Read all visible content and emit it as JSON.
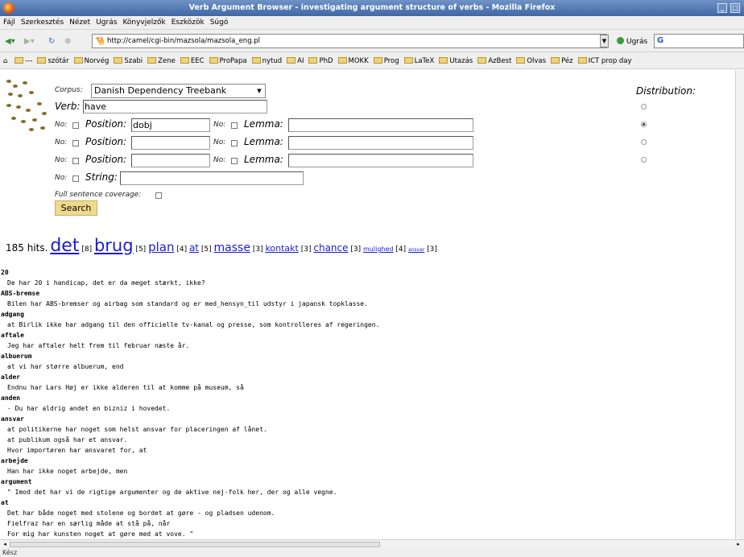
{
  "window": {
    "title": "Verb Argument Browser - investigating argument structure of verbs - Mozilla Firefox"
  },
  "menu": [
    "Fájl",
    "Szerkesztés",
    "Nézet",
    "Ugrás",
    "Könyvjelzők",
    "Eszközök",
    "Súgó"
  ],
  "nav": {
    "url": "http://camel/cgi-bin/mazsola/mazsola_eng.pl",
    "go_label": "Ugrás",
    "search_value": "G"
  },
  "bookmarks": [
    "---",
    "szótár",
    "Norvég",
    "Szabi",
    "Zene",
    "EEC",
    "ProPapa",
    "nytud",
    "AI",
    "PhD",
    "MOKK",
    "Prog",
    "LaTeX",
    "Utazás",
    "AzBest",
    "Olvas",
    "Péz",
    "ICT prop day"
  ],
  "form": {
    "corpus_label": "Corpus:",
    "corpus_value": "Danish Dependency Treebank",
    "verb_label": "Verb:",
    "verb_value": "have",
    "no_label": "No:",
    "position_label": "Position:",
    "lemma_label": "Lemma:",
    "string_label": "String:",
    "rows": [
      {
        "position": "dobj",
        "lemma": ""
      },
      {
        "position": "",
        "lemma": ""
      },
      {
        "position": "",
        "lemma": ""
      }
    ],
    "string_value": "",
    "coverage_label": "Full sentence coverage:",
    "search_label": "Search",
    "distribution_label": "Distribution:"
  },
  "hits": {
    "count_text": "185 hits.",
    "items": [
      {
        "word": "det",
        "count": "[8]"
      },
      {
        "word": "brug",
        "count": "[5]"
      },
      {
        "word": "plan",
        "count": "[4]"
      },
      {
        "word": "at",
        "count": "[5]"
      },
      {
        "word": "masse",
        "count": "[3]"
      },
      {
        "word": "kontakt",
        "count": "[3]"
      },
      {
        "word": "chance",
        "count": "[3]"
      },
      {
        "word": "mulighed",
        "count": "[4]"
      },
      {
        "word": "ansvar",
        "count": "[3]"
      }
    ]
  },
  "results": [
    {
      "word": "20",
      "sentences": [
        "De har 20 i handicap, det er da meget stærkt, ikke?"
      ]
    },
    {
      "word": "ABS-bremse",
      "sentences": [
        "Bilen har ABS-bremser og airbag som standard og er med_hensyn_til udstyr i japansk topklasse."
      ]
    },
    {
      "word": "adgang",
      "sentences": [
        "at Birlik ikke har adgang til den officielle tv-kanal og presse, som kontrolleres af regeringen."
      ]
    },
    {
      "word": "aftale",
      "sentences": [
        "Jeg har aftaler helt frem til februar næste år."
      ]
    },
    {
      "word": "albuerum",
      "sentences": [
        "at vi har større albuerum, end"
      ]
    },
    {
      "word": "alder",
      "sentences": [
        "Endnu har Lars Høj er ikke alderen til at komme på museum, så"
      ]
    },
    {
      "word": "anden",
      "sentences": [
        "- Du har aldrig andet en bizniz i hovedet."
      ]
    },
    {
      "word": "ansvar",
      "sentences": [
        "at politikerne har noget som helst ansvar for placeringen af lånet.",
        "at publikum også har et ansvar.",
        "Hvor importøren har ansvaret for, at"
      ]
    },
    {
      "word": "arbejde",
      "sentences": [
        "Han har ikke noget arbejde, men"
      ]
    },
    {
      "word": "argument",
      "sentences": [
        "\" Imod det har vi de rigtige argumenter og de aktive nej-folk her, der og alle vegne."
      ]
    },
    {
      "word": "at",
      "sentences": [
        "Det har både noget med stolene og bordet at gøre - og pladsen udenom.",
        "Fielfraz har en særlig måde at stå på, når",
        "For mig har kunsten noget at gøre med at vove. \""
      ]
    }
  ],
  "status": {
    "text": "Kész"
  }
}
